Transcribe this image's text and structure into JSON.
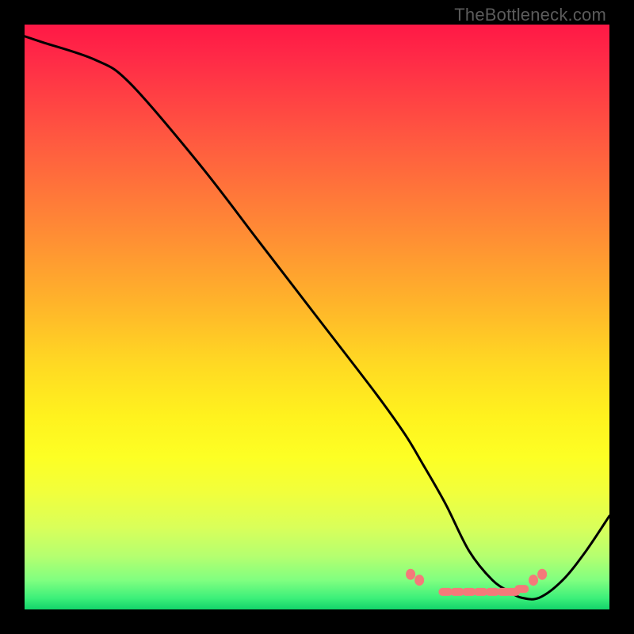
{
  "watermark": "TheBottleneck.com",
  "chart_data": {
    "type": "line",
    "title": "",
    "xlabel": "",
    "ylabel": "",
    "xlim": [
      0,
      100
    ],
    "ylim": [
      0,
      100
    ],
    "series": [
      {
        "name": "curve",
        "x": [
          0,
          3,
          12,
          18,
          30,
          40,
          50,
          60,
          65,
          68,
          72,
          76,
          80,
          83,
          85,
          88,
          92,
          96,
          100
        ],
        "y": [
          98,
          97,
          94,
          90,
          76,
          63,
          50,
          37,
          30,
          25,
          18,
          10,
          5,
          3,
          2,
          2,
          5,
          10,
          16
        ],
        "color": "#000000"
      },
      {
        "name": "highlight-dots",
        "x": [
          66,
          67.5,
          72,
          74,
          76,
          78,
          80,
          82,
          83.5,
          85,
          87,
          88.5
        ],
        "y": [
          6,
          5,
          3,
          3,
          3,
          3,
          3,
          3,
          3,
          3.5,
          5,
          6
        ],
        "color": "#f47a7a"
      }
    ]
  }
}
